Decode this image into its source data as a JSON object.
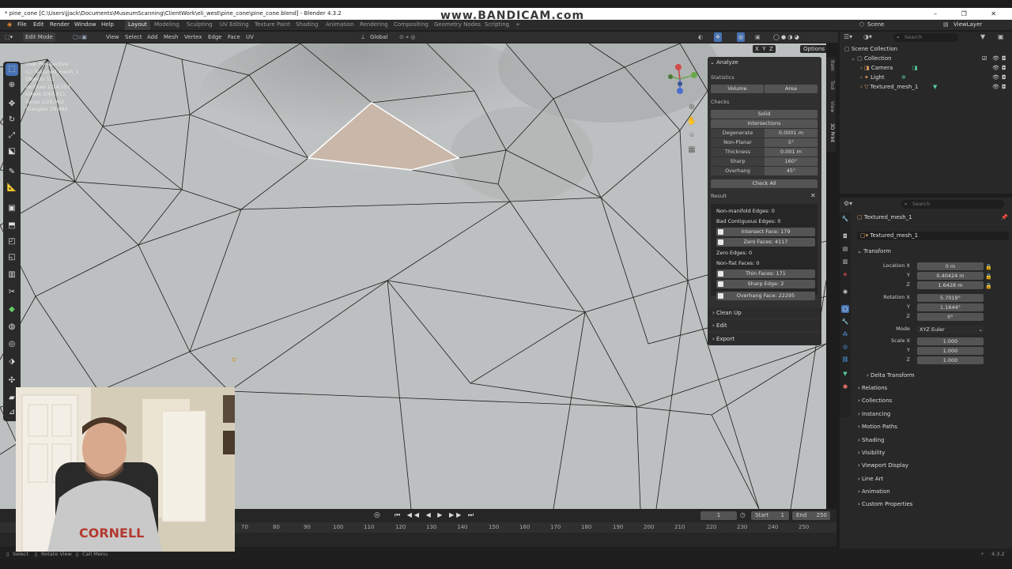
{
  "window": {
    "title": "* pine_cone [C:\\Users\\Jjack\\Documents\\MuseumScanning\\ClientWork\\eli_west\\pine_cone\\pine_cone.blend] - Blender 4.3.2",
    "watermark": "www.BANDICAM.com",
    "controls": "–  ❐  ✕"
  },
  "menu": {
    "items": [
      "File",
      "Edit",
      "Render",
      "Window",
      "Help"
    ],
    "workspaces": [
      "Layout",
      "Modeling",
      "Sculpting",
      "UV Editing",
      "Texture Paint",
      "Shading",
      "Animation",
      "Rendering",
      "Compositing",
      "Geometry Nodes",
      "Scripting"
    ],
    "active_workspace": "Layout",
    "add_tab": "+",
    "scene_label": "Scene",
    "viewlayer_label": "ViewLayer"
  },
  "viewport_header": {
    "mode": "Edit Mode",
    "menus": [
      "View",
      "Select",
      "Add",
      "Mesh",
      "Vertex",
      "Edge",
      "Face",
      "UV"
    ],
    "transform_orientation": "Global",
    "options_label": "Options",
    "axis_labels": [
      "X",
      "Y",
      "Z"
    ]
  },
  "viewport_overlay": {
    "stats_lines": [
      "User Perspective",
      "(1) Textured_mesh_1",
      "Objects   1/1",
      "Vertices  2/14,553",
      "Edges     3/43,611",
      "Faces     1/29,062",
      "Triangles 29,062"
    ]
  },
  "npanel": {
    "tabs": [
      "Item",
      "Tool",
      "View",
      "3D Print"
    ],
    "analyze": {
      "header": "Analyze",
      "statistics_label": "Statistics",
      "volume_btn": "Volume",
      "area_btn": "Area",
      "checks_label": "Checks",
      "solid_btn": "Solid",
      "intersections_btn": "Intersections",
      "checks": [
        {
          "label": "Degenerate",
          "value": "0.0001 m"
        },
        {
          "label": "Non-Planar",
          "value": "5°"
        },
        {
          "label": "Thickness",
          "value": "0.001 m"
        },
        {
          "label": "Sharp",
          "value": "160°"
        },
        {
          "label": "Overhang",
          "value": "45°"
        }
      ],
      "check_all_btn": "Check All"
    },
    "result": {
      "header": "Result",
      "lines": [
        {
          "text": "Non-manifold Edges: 0",
          "button": false
        },
        {
          "text": "Bad Contiguous Edges: 0",
          "button": false
        },
        {
          "text": "Intersect Face: 179",
          "button": true
        },
        {
          "text": "Zero Faces: 4117",
          "button": true
        },
        {
          "text": "Zero Edges: 0",
          "button": false
        },
        {
          "text": "Non-flat Faces: 0",
          "button": false
        },
        {
          "text": "Thin Faces: 171",
          "button": true
        },
        {
          "text": "Sharp Edge: 2",
          "button": true
        },
        {
          "text": "Overhang Face: 22295",
          "button": true
        }
      ]
    },
    "sections": [
      "Clean Up",
      "Edit",
      "Export"
    ]
  },
  "timeline": {
    "current_frame": "1",
    "start_label": "Start",
    "start_value": "1",
    "end_label": "End",
    "end_value": "250",
    "ruler": [
      "70",
      "80",
      "90",
      "100",
      "110",
      "120",
      "130",
      "140",
      "150",
      "160",
      "170",
      "180",
      "190",
      "200",
      "210",
      "220",
      "230",
      "240",
      "250"
    ]
  },
  "outliner": {
    "search_placeholder": "Search",
    "rows": [
      {
        "label": "Scene Collection",
        "indent": 0,
        "icon": "scene-collection-icon"
      },
      {
        "label": "Collection",
        "indent": 1,
        "icon": "collection-icon"
      },
      {
        "label": "Camera",
        "indent": 2,
        "icon": "camera-icon"
      },
      {
        "label": "Light",
        "indent": 2,
        "icon": "light-icon"
      },
      {
        "label": "Textured_mesh_1",
        "indent": 2,
        "icon": "mesh-icon"
      }
    ]
  },
  "properties": {
    "search_placeholder": "Search",
    "object_name": "Textured_mesh_1",
    "object_field": "Textured_mesh_1",
    "transform_header": "Transform",
    "location": {
      "label": "Location X",
      "x": "0 m",
      "y": "0.40424 m",
      "z": "1.6428 m"
    },
    "rotation": {
      "label": "Rotation X",
      "x": "5.7019°",
      "y": "1.1644°",
      "z": "0°"
    },
    "mode_label": "Mode",
    "mode_value": "XYZ Euler",
    "scale": {
      "label": "Scale X",
      "x": "1.000",
      "y": "1.000",
      "z": "1.000"
    },
    "axis_y": "Y",
    "axis_z": "Z",
    "delta_transform": "Delta Transform",
    "sections": [
      "Relations",
      "Collections",
      "Instancing",
      "Motion Paths",
      "Shading",
      "Visibility",
      "Viewport Display",
      "Line Art",
      "Animation",
      "Custom Properties"
    ]
  },
  "statusbar": {
    "items": [
      "Select",
      "Rotate View",
      "Call Menu"
    ],
    "version": "4.3.2"
  },
  "colors": {
    "accent": "#4772b3",
    "panel": "#303030",
    "viewport": "#b9bcbc",
    "selected_face": "#c7b5a8"
  }
}
